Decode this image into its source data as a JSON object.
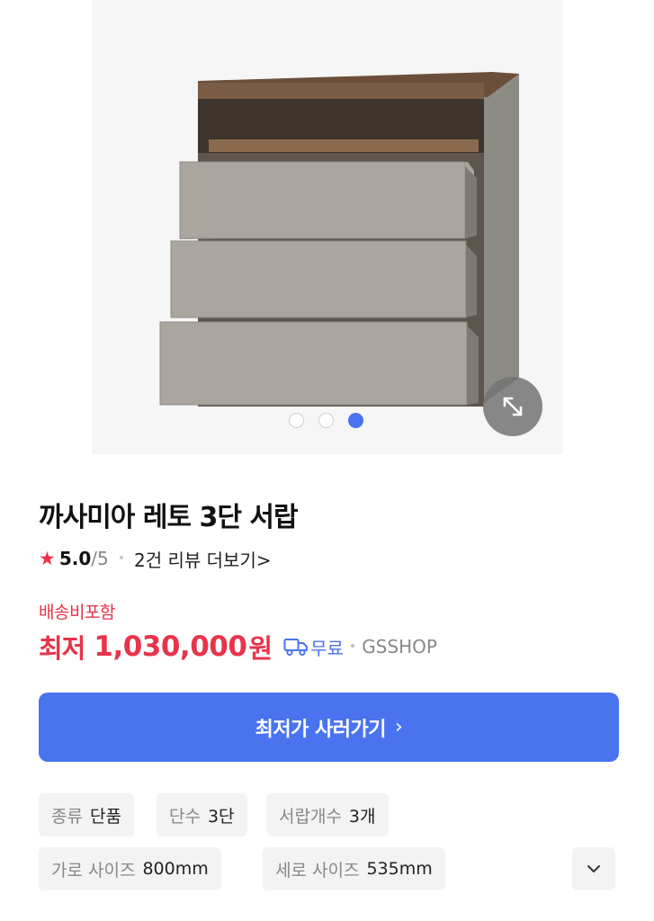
{
  "product": {
    "title": "까사미아 레토 3단 서랍",
    "image_alt": "3-drawer chest, gray drawers with walnut top",
    "gallery": {
      "total": 3,
      "active_index": 2
    }
  },
  "rating": {
    "score": "5.0",
    "out_of": "/5",
    "review_link": "2건 리뷰 더보기>"
  },
  "shipping_note": "배송비포함",
  "price": {
    "label": "최저",
    "value": "1,030,000",
    "unit": "원",
    "delivery": "무료",
    "mall": "GSSHOP"
  },
  "cta": {
    "label": "최저가 사러가기",
    "chevron": "›"
  },
  "specs": [
    {
      "key": "종류",
      "value": "단품"
    },
    {
      "key": "단수",
      "value": "3단"
    },
    {
      "key": "서랍개수",
      "value": "3개"
    },
    {
      "key": "가로 사이즈",
      "value": "800mm"
    },
    {
      "key": "세로 사이즈",
      "value": "535mm"
    }
  ],
  "icons": {
    "star": "star-icon",
    "truck": "truck-icon",
    "expand": "expand-icon",
    "chevron_down": "chevron-down-icon"
  },
  "colors": {
    "accent": "#4a73f0",
    "price": "#e8334a",
    "chip_bg": "#f3f3f3"
  }
}
